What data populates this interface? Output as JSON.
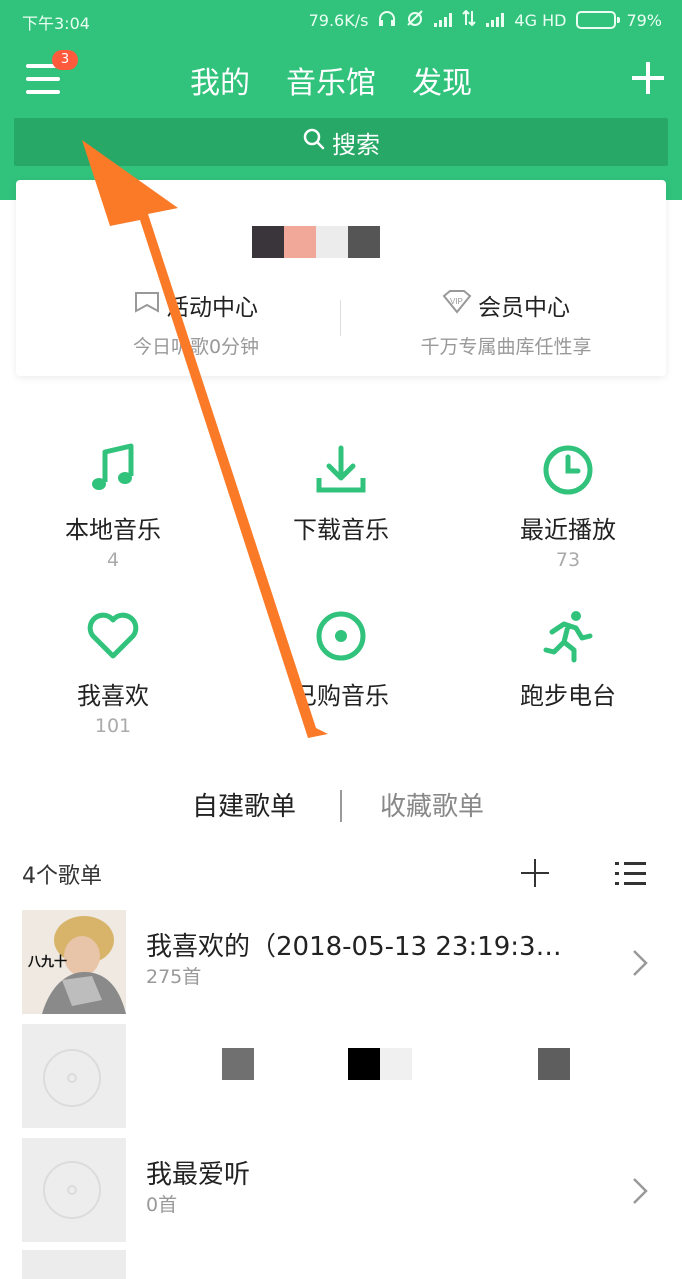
{
  "status_bar": {
    "time": "下午3:04",
    "speed": "79.6K/s",
    "network": "4G HD",
    "battery_percent": "79%",
    "battery_level": 0.79,
    "battery_color": "#ffa51e"
  },
  "header": {
    "accent_color": "#31c27c",
    "menu_badge": "3",
    "tabs": [
      {
        "label": "我的"
      },
      {
        "label": "音乐馆"
      },
      {
        "label": "发现"
      }
    ],
    "search_label": "搜索"
  },
  "card": {
    "activity": {
      "title": "活动中心",
      "subtitle": "今日听歌0分钟"
    },
    "vip": {
      "title": "会员中心",
      "subtitle": "千万专属曲库任性享",
      "badge": "VIP"
    },
    "mosaic_colors": [
      "#3a353a",
      "#f2a898",
      "#ececec",
      "#555555"
    ]
  },
  "grid": [
    {
      "label": "本地音乐",
      "count": "4",
      "icon": "music-note-icon"
    },
    {
      "label": "下载音乐",
      "count": "",
      "icon": "download-icon"
    },
    {
      "label": "最近播放",
      "count": "73",
      "icon": "clock-icon"
    },
    {
      "label": "我喜欢",
      "count": "101",
      "icon": "heart-icon"
    },
    {
      "label": "已购音乐",
      "count": "",
      "icon": "disc-icon"
    },
    {
      "label": "跑步电台",
      "count": "",
      "icon": "running-icon"
    }
  ],
  "segments": {
    "created": "自建歌单",
    "collected": "收藏歌单"
  },
  "playlist_header": {
    "count_label": "4个歌单"
  },
  "playlists": [
    {
      "name": "我喜欢的（2018-05-13 23:19:3…",
      "count": "275首",
      "cover_text": "八九十"
    },
    {
      "name": "",
      "count": "",
      "cover_text": ""
    },
    {
      "name": "我最爱听",
      "count": "0首",
      "cover_text": ""
    }
  ],
  "annotation": {
    "arrow_color": "#fb7a28"
  }
}
